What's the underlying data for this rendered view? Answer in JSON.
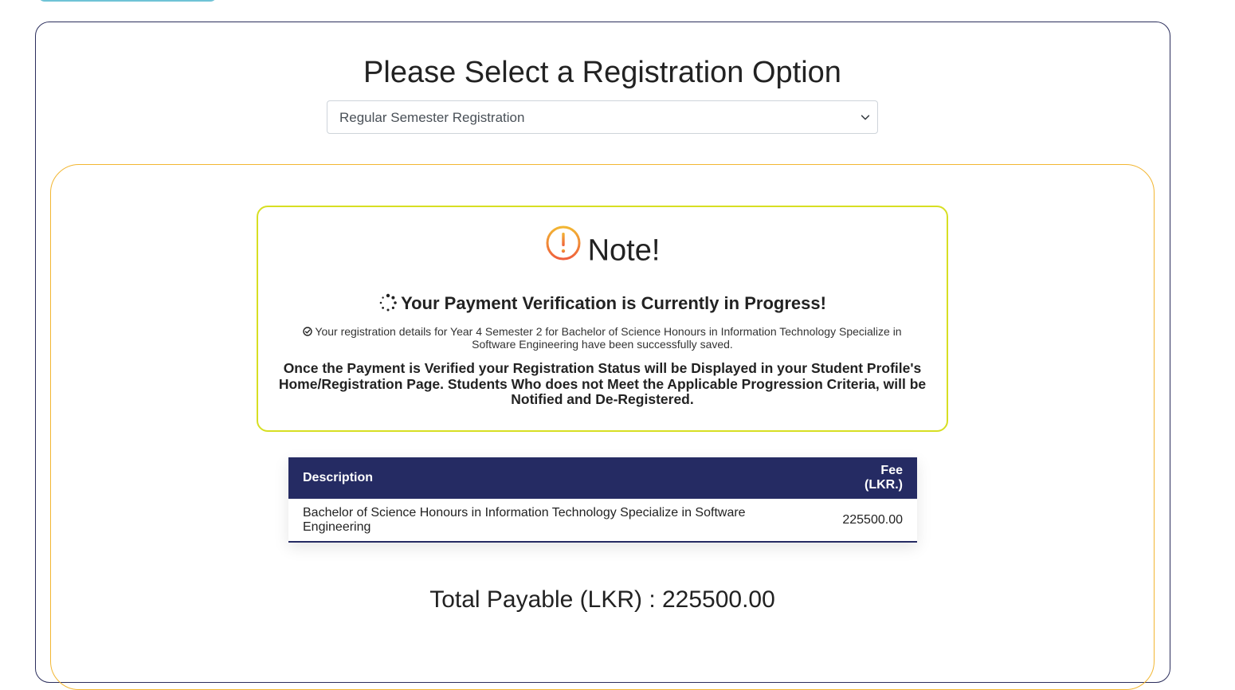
{
  "page": {
    "title": "Please Select a Registration Option"
  },
  "registration_select": {
    "selected": "Regular Semester Registration"
  },
  "note": {
    "heading": "Note!",
    "progress_message": "Your Payment Verification is Currently in Progress!",
    "saved_message": "Your registration details for Year 4 Semester 2 for Bachelor of Science Honours in Information Technology Specialize in Software Engineering have been successfully saved.",
    "verification_message": "Once the Payment is Verified your Registration Status will be Displayed in your Student Profile's Home/Registration Page. Students Who does not Meet the Applicable Progression Criteria, will be Notified and De-Registered."
  },
  "fee_table": {
    "columns": {
      "description": "Description",
      "fee": "Fee (LKR.)"
    },
    "rows": [
      {
        "description": "Bachelor of Science Honours in Information Technology Specialize in Software Engineering",
        "fee": "225500.00"
      }
    ]
  },
  "total": {
    "text": "Total Payable (LKR) : 225500.00"
  },
  "colors": {
    "table_header": "#252b63",
    "note_border": "#d7df23",
    "inner_card_border": "#f2b632",
    "alert_icon_gradient_start": "#f2b632",
    "alert_icon_gradient_end": "#ef5f3c"
  },
  "icons": {
    "note": "alert-circle-icon",
    "progress": "spinner-icon",
    "saved": "check-circle-icon",
    "select": "chevron-down-icon"
  }
}
